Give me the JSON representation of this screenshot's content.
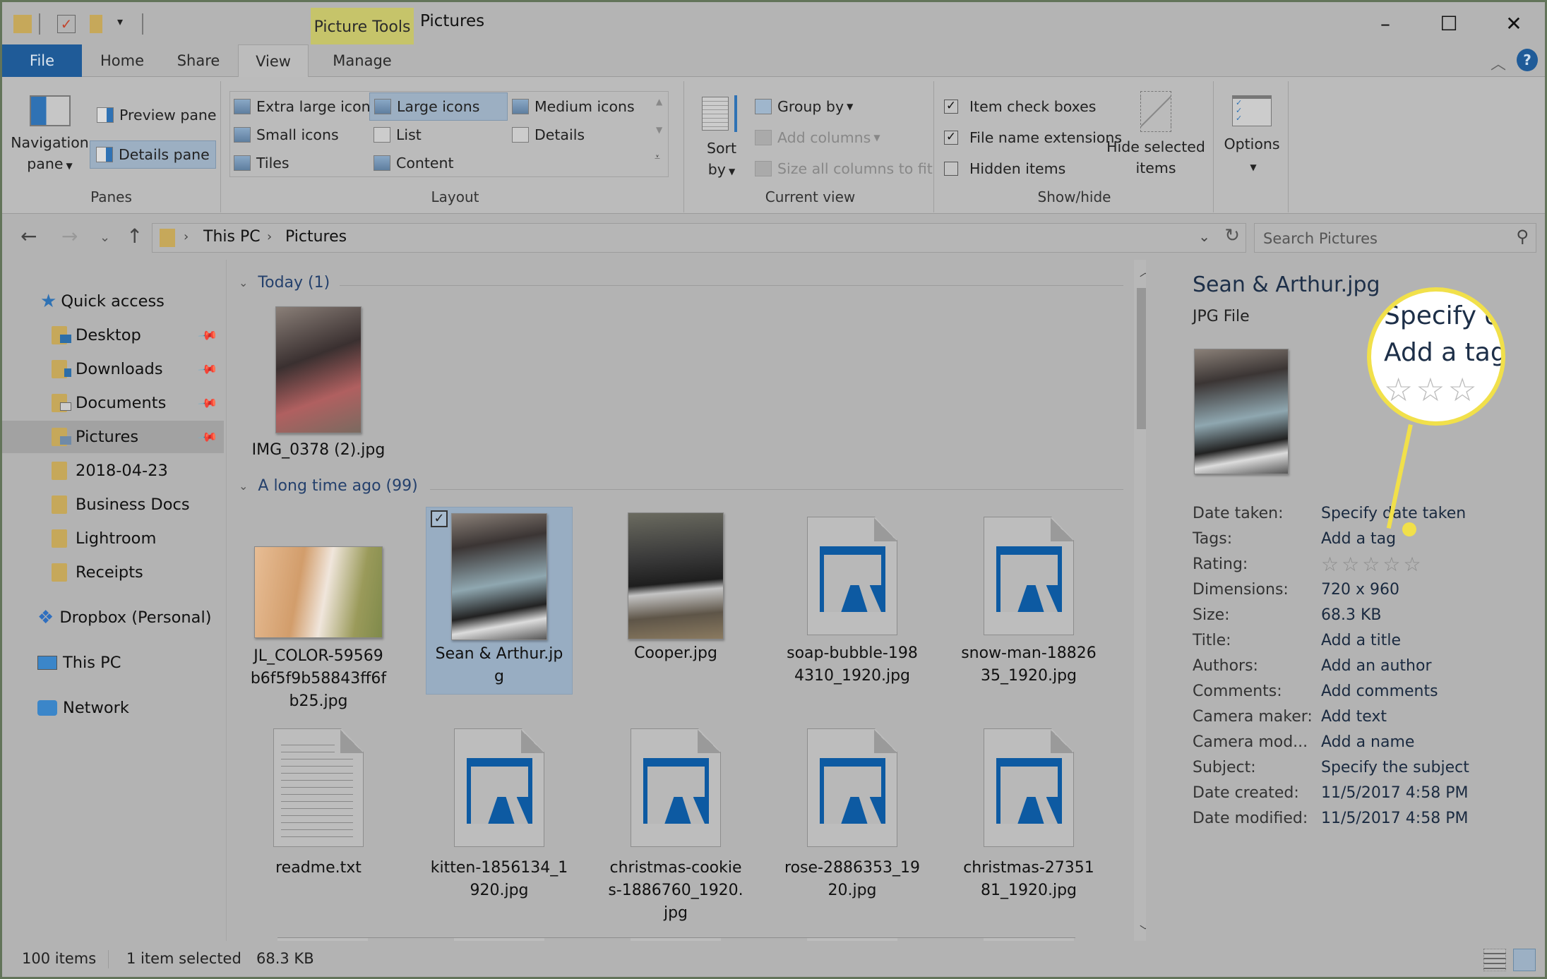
{
  "window": {
    "contextual_tab_group": "Picture Tools",
    "title": "Pictures",
    "controls": {
      "minimize": "–",
      "maximize": "☐",
      "close": "✕"
    }
  },
  "tabs": [
    {
      "label": "File",
      "active": false
    },
    {
      "label": "Home",
      "active": false
    },
    {
      "label": "Share",
      "active": false
    },
    {
      "label": "View",
      "active": true
    },
    {
      "label": "Manage",
      "active": false
    }
  ],
  "help_label": "?",
  "ribbon": {
    "panes": {
      "label": "Panes",
      "navigation_pane": "Navigation pane",
      "preview_pane": "Preview pane",
      "details_pane": "Details pane",
      "details_pane_selected": true
    },
    "layout": {
      "label": "Layout",
      "options": [
        {
          "label": "Extra large icons",
          "selected": false
        },
        {
          "label": "Large icons",
          "selected": true
        },
        {
          "label": "Medium icons",
          "selected": false
        },
        {
          "label": "Small icons",
          "selected": false
        },
        {
          "label": "List",
          "selected": false
        },
        {
          "label": "Details",
          "selected": false
        },
        {
          "label": "Tiles",
          "selected": false
        },
        {
          "label": "Content",
          "selected": false
        }
      ]
    },
    "current_view": {
      "label": "Current view",
      "sort_by": "Sort by",
      "group_by": "Group by",
      "add_columns": "Add columns",
      "size_columns": "Size all columns to fit"
    },
    "show_hide": {
      "label": "Show/hide",
      "item_check_boxes": {
        "label": "Item check boxes",
        "checked": true
      },
      "file_name_extensions": {
        "label": "File name extensions",
        "checked": true
      },
      "hidden_items": {
        "label": "Hidden items",
        "checked": false
      },
      "hide_selected": "Hide selected items"
    },
    "options": {
      "label": "Options"
    }
  },
  "address": {
    "breadcrumb": [
      "This PC",
      "Pictures"
    ],
    "search_placeholder": "Search Pictures"
  },
  "nav": {
    "quick_access": "Quick access",
    "pinned": [
      "Desktop",
      "Downloads",
      "Documents",
      "Pictures"
    ],
    "folders": [
      "2018-04-23",
      "Business Docs",
      "Lightroom",
      "Receipts"
    ],
    "selected": "Pictures",
    "dropbox": "Dropbox (Personal)",
    "this_pc": "This PC",
    "network": "Network"
  },
  "content": {
    "groups": [
      {
        "header": "Today (1)",
        "files": [
          {
            "name": "IMG_0378 (2).jpg",
            "type": "photo"
          }
        ]
      },
      {
        "header": "A long time ago (99)",
        "files": [
          {
            "name": "JL_COLOR-59569b6f5f9b58843ff6fb25.jpg",
            "type": "photo"
          },
          {
            "name": "Sean & Arthur.jpg",
            "type": "photo",
            "selected": true,
            "checked": true
          },
          {
            "name": "Cooper.jpg",
            "type": "photo"
          },
          {
            "name": "soap-bubble-1984310_1920.jpg",
            "type": "image-generic"
          },
          {
            "name": "snow-man-1882635_1920.jpg",
            "type": "image-generic"
          },
          {
            "name": "readme.txt",
            "type": "text"
          },
          {
            "name": "kitten-1856134_1920.jpg",
            "type": "image-generic"
          },
          {
            "name": "christmas-cookies-1886760_1920.jpg",
            "type": "image-generic"
          },
          {
            "name": "rose-2886353_1920.jpg",
            "type": "image-generic"
          },
          {
            "name": "christmas-2735181_1920.jpg",
            "type": "image-generic"
          }
        ]
      }
    ]
  },
  "details": {
    "file_name": "Sean & Arthur.jpg",
    "file_type": "JPG File",
    "properties": [
      {
        "label": "Date taken:",
        "value": "Specify date taken"
      },
      {
        "label": "Tags:",
        "value": "Add a tag"
      },
      {
        "label": "Rating:",
        "value": "",
        "stars": 0,
        "max_stars": 5
      },
      {
        "label": "Dimensions:",
        "value": "720 x 960"
      },
      {
        "label": "Size:",
        "value": "68.3 KB"
      },
      {
        "label": "Title:",
        "value": "Add a title"
      },
      {
        "label": "Authors:",
        "value": "Add an author"
      },
      {
        "label": "Comments:",
        "value": "Add comments"
      },
      {
        "label": "Camera maker:",
        "value": "Add text"
      },
      {
        "label": "Camera mod...",
        "value": "Add a name"
      },
      {
        "label": "Subject:",
        "value": "Specify the subject"
      },
      {
        "label": "Date created:",
        "value": "11/5/2017 4:58 PM"
      },
      {
        "label": "Date modified:",
        "value": "11/5/2017 4:58 PM"
      }
    ]
  },
  "callout": {
    "line1": "Specify da",
    "line2": "Add a tag",
    "stars": "☆☆☆"
  },
  "status": {
    "item_count": "100 items",
    "selection": "1 item selected",
    "selection_size": "68.3 KB"
  },
  "colors": {
    "file_tab": "#1f5b98",
    "picture_tools": "#c6c46a",
    "selection": "#98adc2",
    "callout": "#f1e04a",
    "image_icon": "#0d5aa2"
  }
}
